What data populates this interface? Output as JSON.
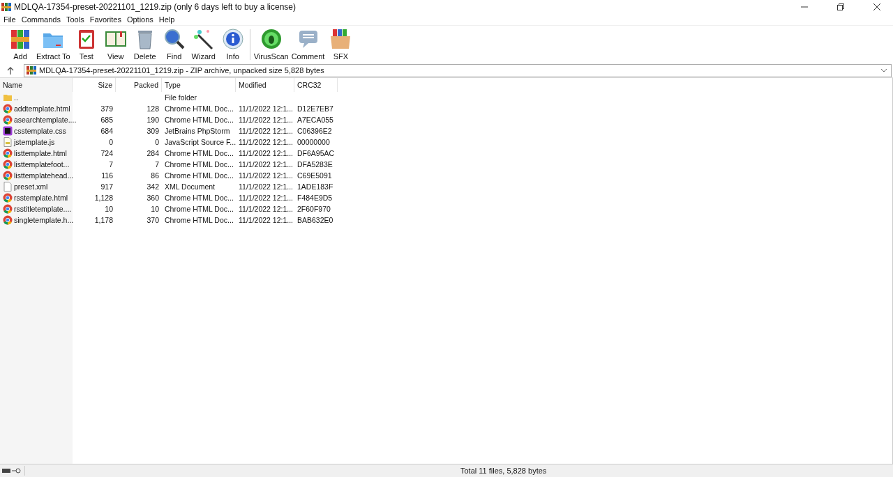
{
  "window": {
    "title": "MDLQA-17354-preset-20221101_1219.zip (only 6 days left to buy a license)"
  },
  "menu": [
    "File",
    "Commands",
    "Tools",
    "Favorites",
    "Options",
    "Help"
  ],
  "toolbar": [
    {
      "label": "Add",
      "kind": "add"
    },
    {
      "label": "Extract To",
      "kind": "extract"
    },
    {
      "label": "Test",
      "kind": "test"
    },
    {
      "label": "View",
      "kind": "view"
    },
    {
      "label": "Delete",
      "kind": "delete"
    },
    {
      "label": "Find",
      "kind": "find"
    },
    {
      "label": "Wizard",
      "kind": "wizard"
    },
    {
      "label": "Info",
      "kind": "info"
    },
    {
      "label": "VirusScan",
      "kind": "virus"
    },
    {
      "label": "Comment",
      "kind": "comment"
    },
    {
      "label": "SFX",
      "kind": "sfx"
    }
  ],
  "address": "MDLQA-17354-preset-20221101_1219.zip - ZIP archive, unpacked size 5,828 bytes",
  "table": {
    "columns": [
      "Name",
      "Size",
      "Packed",
      "Type",
      "Modified",
      "CRC32"
    ],
    "rows": [
      {
        "kind": "folder",
        "name": "..",
        "size": "",
        "packed": "",
        "type": "File folder",
        "modified": "",
        "crc": ""
      },
      {
        "kind": "chrome",
        "name": "addtemplate.html",
        "size": "379",
        "packed": "128",
        "type": "Chrome HTML Doc...",
        "modified": "11/1/2022 12:1...",
        "crc": "D12E7EB7"
      },
      {
        "kind": "chrome",
        "name": "asearchtemplate....",
        "size": "685",
        "packed": "190",
        "type": "Chrome HTML Doc...",
        "modified": "11/1/2022 12:1...",
        "crc": "A7ECA055"
      },
      {
        "kind": "phpstorm",
        "name": "csstemplate.css",
        "size": "684",
        "packed": "309",
        "type": "JetBrains PhpStorm",
        "modified": "11/1/2022 12:1...",
        "crc": "C06396E2"
      },
      {
        "kind": "js",
        "name": "jstemplate.js",
        "size": "0",
        "packed": "0",
        "type": "JavaScript Source F...",
        "modified": "11/1/2022 12:1...",
        "crc": "00000000"
      },
      {
        "kind": "chrome",
        "name": "listtemplate.html",
        "size": "724",
        "packed": "284",
        "type": "Chrome HTML Doc...",
        "modified": "11/1/2022 12:1...",
        "crc": "DF6A95AC"
      },
      {
        "kind": "chrome",
        "name": "listtemplatefoot...",
        "size": "7",
        "packed": "7",
        "type": "Chrome HTML Doc...",
        "modified": "11/1/2022 12:1...",
        "crc": "DFA5283E"
      },
      {
        "kind": "chrome",
        "name": "listtemplatehead...",
        "size": "116",
        "packed": "86",
        "type": "Chrome HTML Doc...",
        "modified": "11/1/2022 12:1...",
        "crc": "C69E5091"
      },
      {
        "kind": "file",
        "name": "preset.xml",
        "size": "917",
        "packed": "342",
        "type": "XML Document",
        "modified": "11/1/2022 12:1...",
        "crc": "1ADE183F"
      },
      {
        "kind": "chrome",
        "name": "rsstemplate.html",
        "size": "1,128",
        "packed": "360",
        "type": "Chrome HTML Doc...",
        "modified": "11/1/2022 12:1...",
        "crc": "F484E9D5"
      },
      {
        "kind": "chrome",
        "name": "rsstitletemplate....",
        "size": "10",
        "packed": "10",
        "type": "Chrome HTML Doc...",
        "modified": "11/1/2022 12:1...",
        "crc": "2F60F970"
      },
      {
        "kind": "chrome",
        "name": "singletemplate.h...",
        "size": "1,178",
        "packed": "370",
        "type": "Chrome HTML Doc...",
        "modified": "11/1/2022 12:1...",
        "crc": "BAB632E0"
      }
    ]
  },
  "status_bar": {
    "text": "Total 11 files, 5,828 bytes"
  }
}
